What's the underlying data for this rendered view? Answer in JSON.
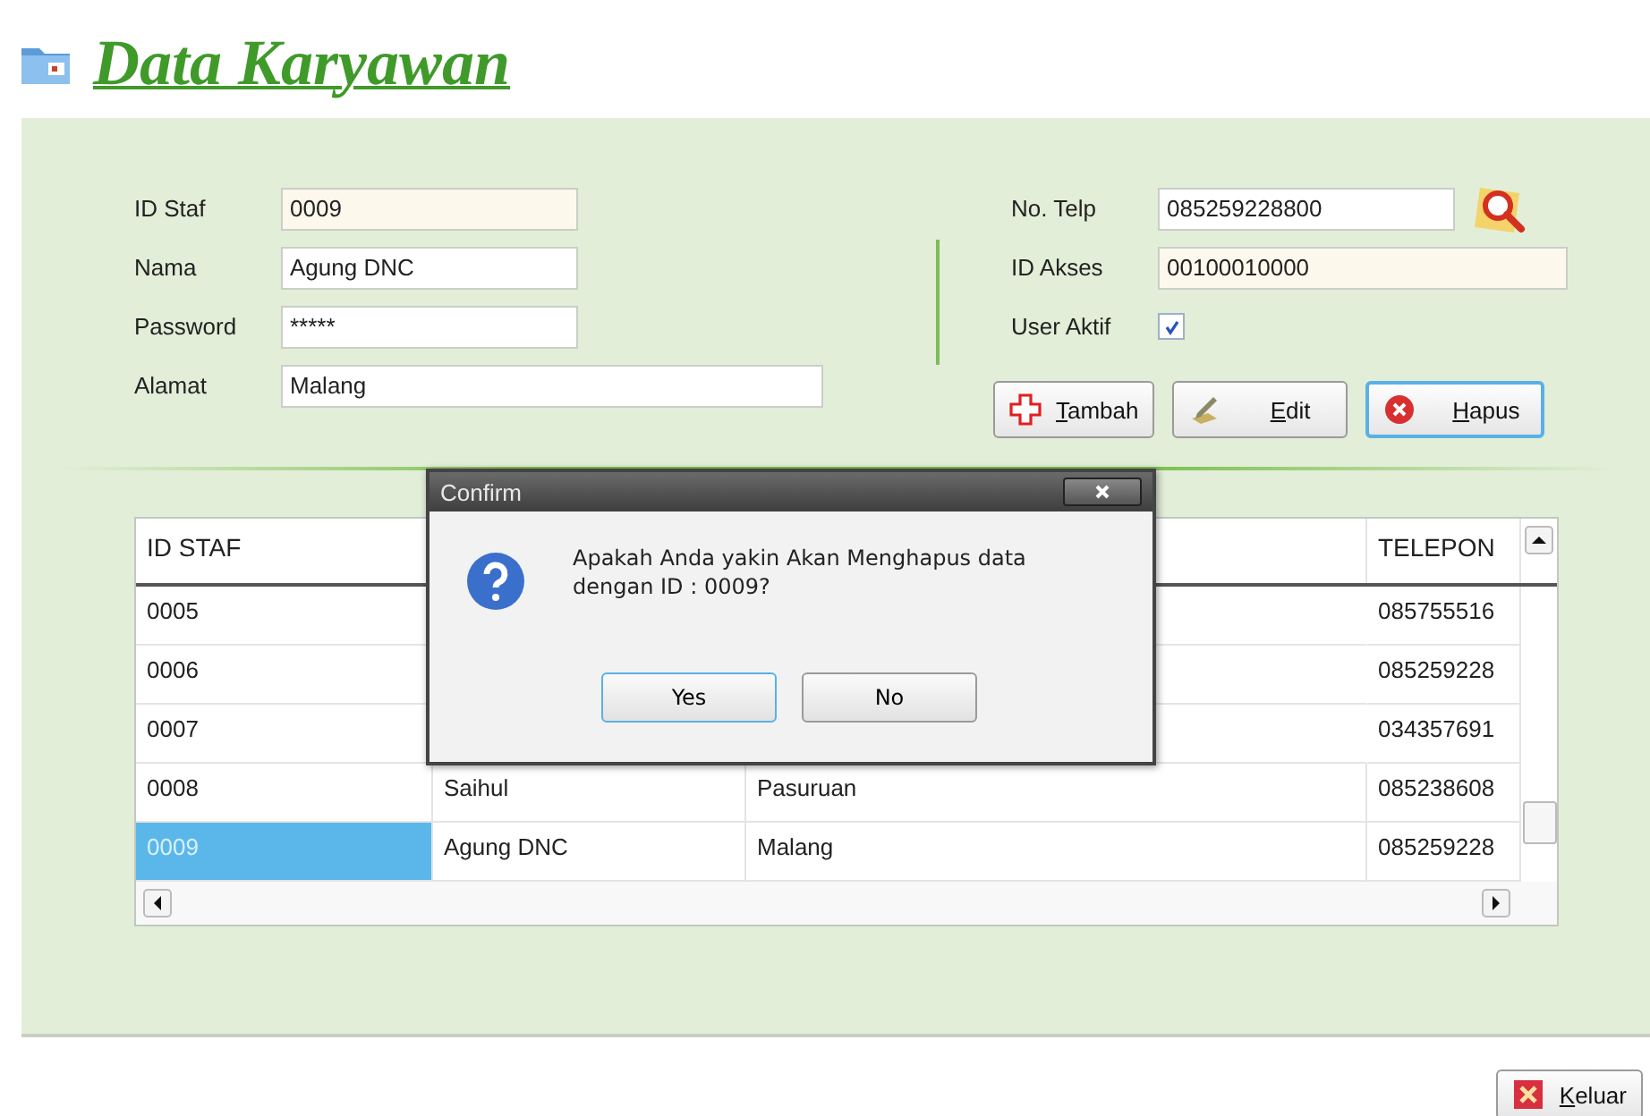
{
  "title": "Data Karyawan",
  "form_left": [
    {
      "label": "ID Staf",
      "value": "0009",
      "readonly": true
    },
    {
      "label": "Nama",
      "value": "Agung DNC",
      "readonly": false
    },
    {
      "label": "Password",
      "value": "*****",
      "readonly": false
    },
    {
      "label": "Alamat",
      "value": "Malang",
      "readonly": false
    }
  ],
  "form_right": [
    {
      "label": "No. Telp",
      "value": "085259228800",
      "readonly": false
    },
    {
      "label": "ID Akses",
      "value": "00100010000",
      "readonly": true
    }
  ],
  "user_aktif": {
    "label": "User Aktif",
    "checked": true
  },
  "buttons": [
    {
      "label": "Tambah",
      "kind": "add",
      "focused": false
    },
    {
      "label": "Edit",
      "kind": "edit",
      "focused": false
    },
    {
      "label": "Hapus",
      "kind": "delete",
      "focused": true
    }
  ],
  "table": {
    "columns": [
      "ID STAF",
      "TELEPON"
    ],
    "rows": [
      {
        "id_staf": "0005",
        "telepon": "085755516",
        "selected": false
      },
      {
        "id_staf": "0006",
        "telepon": "085259228",
        "selected": false
      },
      {
        "id_staf": "0007",
        "telepon": "034357691",
        "selected": false
      },
      {
        "id_staf": "0008",
        "column_2": "Saihul",
        "column_3": "Pasuruan",
        "telepon": "085238608",
        "selected": false
      },
      {
        "id_staf": "0009",
        "column_2": "Agung DNC",
        "column_3": "Malang",
        "telepon": "085259228",
        "selected": true
      }
    ]
  },
  "dialog": {
    "title": "Confirm",
    "message": "Apakah Anda yakin Akan Menghapus data dengan ID : 0009?",
    "buttons": [
      {
        "label": "Yes",
        "selected": true
      },
      {
        "label": "No",
        "selected": false
      }
    ]
  },
  "exit_button": {
    "label": "Keluar"
  }
}
